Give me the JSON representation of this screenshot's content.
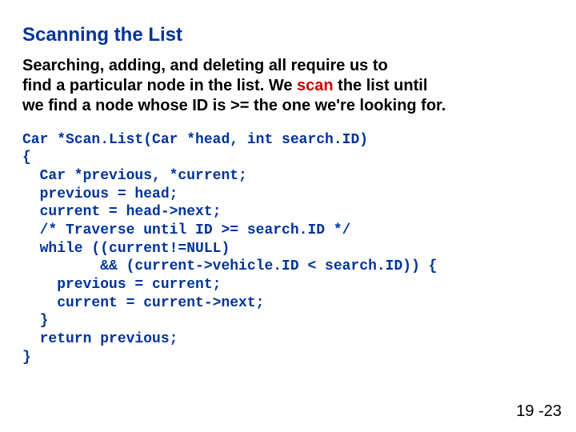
{
  "title": "Scanning the List",
  "body": {
    "p1a": "Searching, adding, and deleting all require us to",
    "p2a": "find a particular node in the list.  We ",
    "scan": "scan",
    "p2b": " the list until",
    "p3": "we find a node whose ID is >= the one we're looking for."
  },
  "code": {
    "l1": "Car *Scan.List(Car *head, int search.ID)",
    "l2": "{",
    "l3": "  Car *previous, *current;",
    "l4": "  previous = head;",
    "l5": "  current = head->next;",
    "l6": "  /* Traverse until ID >= search.ID */",
    "l7": "  while ((current!=NULL) ",
    "l8": "         && (current->vehicle.ID < search.ID)) {",
    "l9": "    previous = current;",
    "l10": "    current = current->next;",
    "l11": "  }",
    "l12": "  return previous;",
    "l13": "}"
  },
  "page_number": "19 -23"
}
